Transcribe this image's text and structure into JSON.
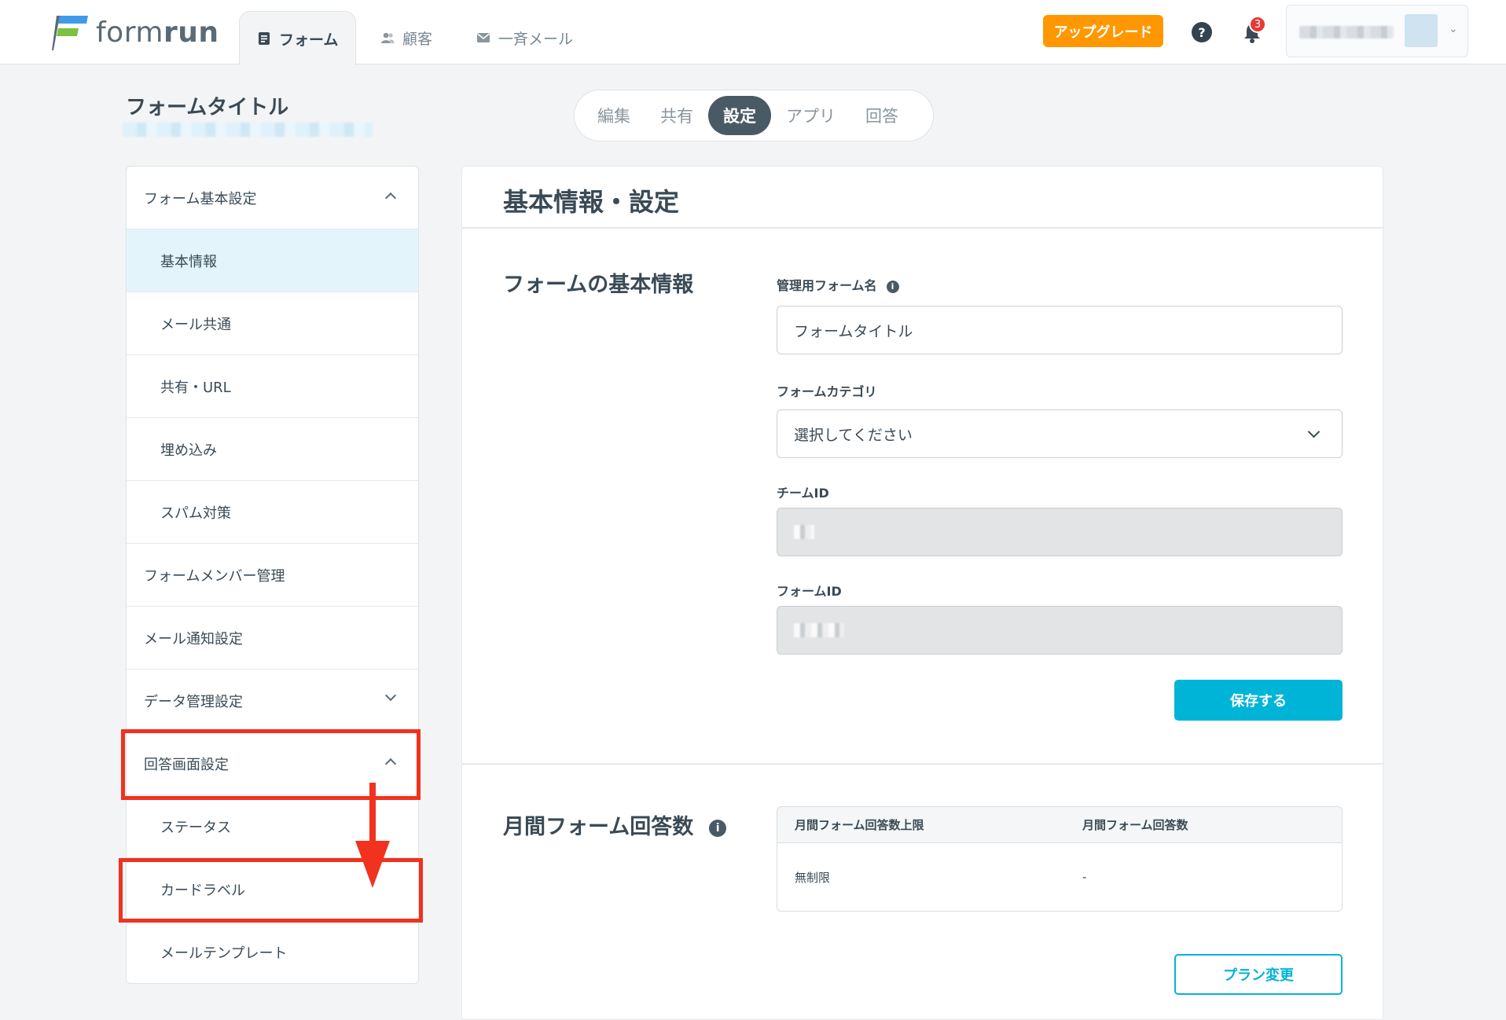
{
  "header": {
    "logo_text_light": "form",
    "logo_text_bold": "run",
    "nav_tabs": [
      {
        "label": "フォーム",
        "icon": "document-icon"
      },
      {
        "label": "顧客",
        "icon": "users-icon"
      },
      {
        "label": "一斉メール",
        "icon": "mail-icon"
      }
    ],
    "upgrade_label": "アップグレード",
    "help_label": "?",
    "notification_count": "3"
  },
  "form": {
    "title": "フォームタイトル",
    "tabs": [
      "編集",
      "共有",
      "設定",
      "アプリ",
      "回答"
    ],
    "active_tab": "設定"
  },
  "sidebar": {
    "items": [
      {
        "label": "フォーム基本設定",
        "level": "group",
        "chevron": "up"
      },
      {
        "label": "基本情報",
        "level": "sub",
        "active": true
      },
      {
        "label": "メール共通",
        "level": "sub"
      },
      {
        "label": "共有・URL",
        "level": "sub"
      },
      {
        "label": "埋め込み",
        "level": "sub"
      },
      {
        "label": "スパム対策",
        "level": "sub"
      },
      {
        "label": "フォームメンバー管理",
        "level": "group"
      },
      {
        "label": "メール通知設定",
        "level": "group"
      },
      {
        "label": "データ管理設定",
        "level": "group",
        "chevron": "down"
      },
      {
        "label": "回答画面設定",
        "level": "group",
        "chevron": "up"
      },
      {
        "label": "ステータス",
        "level": "sub"
      },
      {
        "label": "カードラベル",
        "level": "sub"
      },
      {
        "label": "メールテンプレート",
        "level": "sub"
      }
    ]
  },
  "panel": {
    "title": "基本情報・設定",
    "basic_section_title": "フォームの基本情報",
    "form_name_label": "管理用フォーム名",
    "form_name_value": "フォームタイトル",
    "category_label": "フォームカテゴリ",
    "category_value": "選択してください",
    "team_id_label": "チームID",
    "form_id_label": "フォームID",
    "save_label": "保存する",
    "usage_section_title": "月間フォーム回答数",
    "usage_headers": [
      "月間フォーム回答数上限",
      "月間フォーム回答数"
    ],
    "usage_values": [
      "無制限",
      "-"
    ],
    "plan_change_label": "プラン変更"
  },
  "colors": {
    "accent": "#00b4d8",
    "upgrade": "#ff9800",
    "annotation": "#f0321e",
    "active_tab": "#4a5a64",
    "active_sidebar": "#e3f5fb"
  }
}
